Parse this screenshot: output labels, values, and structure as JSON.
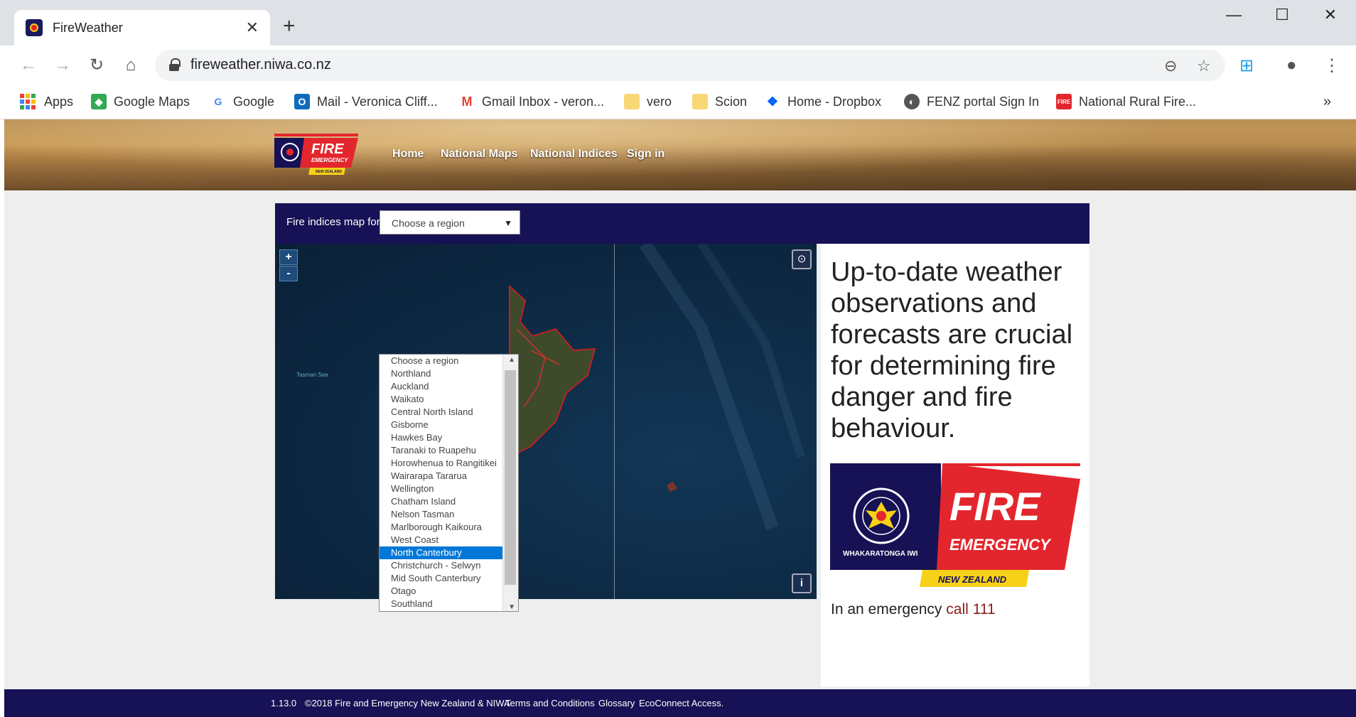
{
  "browser": {
    "tab_title": "FireWeather",
    "url": "fireweather.niwa.co.nz",
    "bookmarks": [
      {
        "label": "Apps",
        "icon": "apps-grid-icon"
      },
      {
        "label": "Google Maps",
        "icon": "google-maps-icon"
      },
      {
        "label": "Google",
        "icon": "google-icon"
      },
      {
        "label": "Mail - Veronica Cliff...",
        "icon": "outlook-icon"
      },
      {
        "label": "Gmail Inbox - veron...",
        "icon": "gmail-icon"
      },
      {
        "label": "vero",
        "icon": "folder-icon"
      },
      {
        "label": "Scion",
        "icon": "folder-icon"
      },
      {
        "label": "Home - Dropbox",
        "icon": "dropbox-icon"
      },
      {
        "label": "FENZ portal Sign In",
        "icon": "globe-icon"
      },
      {
        "label": "National Rural Fire...",
        "icon": "fire-icon"
      }
    ],
    "more_bookmarks": "»"
  },
  "site": {
    "nav": [
      "Home",
      "National Maps",
      "National Indices",
      "Sign in"
    ],
    "logo_text": {
      "fire": "FIRE",
      "emergency": "EMERGENCY",
      "nz": "NEW ZEALAND"
    }
  },
  "panel": {
    "label": "Fire indices map for",
    "select_value": "Choose a region",
    "regions": [
      "Choose a region",
      "Northland",
      "Auckland",
      "Waikato",
      "Central North Island",
      "Gisborne",
      "Hawkes Bay",
      "Taranaki to Ruapehu",
      "Horowhenua to Rangitikei",
      "Wairarapa Tararua",
      "Wellington",
      "Chatham Island",
      "Nelson Tasman",
      "Marlborough Kaikoura",
      "West Coast",
      "North Canterbury",
      "Christchurch - Selwyn",
      "Mid South Canterbury",
      "Otago",
      "Southland"
    ],
    "highlighted_region": "North Canterbury"
  },
  "map": {
    "zoom_in": "+",
    "zoom_out": "-",
    "locate": "⊙",
    "info": "i"
  },
  "side": {
    "headline": "Up-to-date weather observations and forecasts are crucial for determining fire danger and fire behaviour.",
    "logo_text": {
      "fire": "FIRE",
      "emergency": "EMERGENCY",
      "iwi": "WHAKARATONGA IWI",
      "nz": "NEW ZEALAND"
    },
    "emergency_prefix": "In an emergency",
    "emergency_call": "call 111"
  },
  "footer": {
    "version": "1.13.0",
    "copyright": "©2018 Fire and Emergency New Zealand & NIWA",
    "links": [
      "Terms and Conditions",
      "Glossary",
      "EcoConnect Access."
    ]
  },
  "colors": {
    "navy": "#171155",
    "fenz_red": "#e3262d",
    "fenz_yellow": "#f7d117",
    "highlight": "#0078d7"
  }
}
